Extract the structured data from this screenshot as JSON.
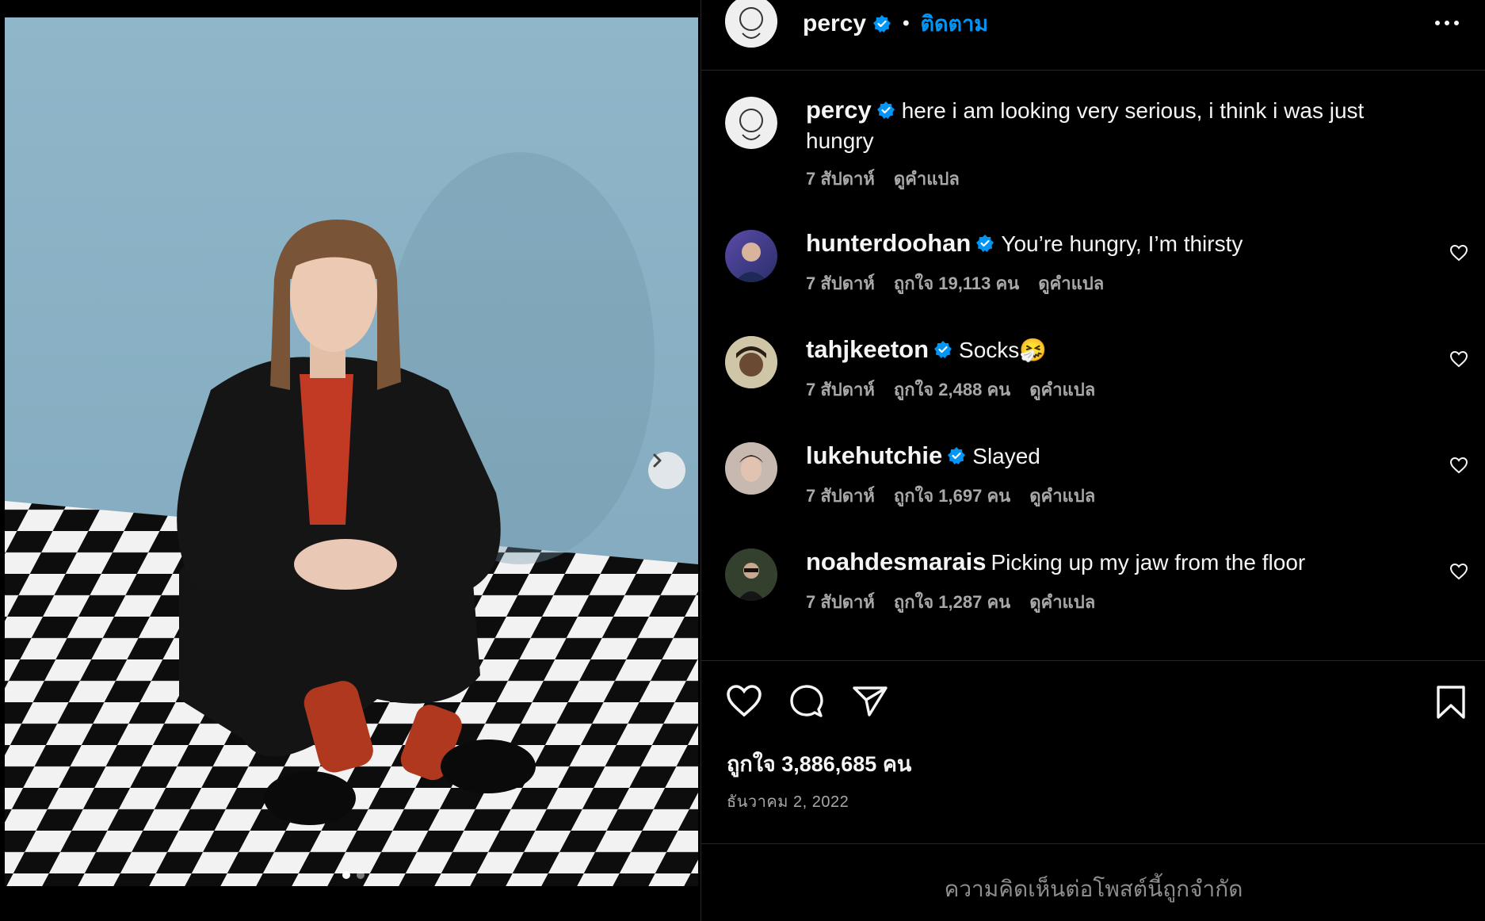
{
  "post": {
    "author": "percy",
    "follow_label": "ติดตาม",
    "dot_separator": "•",
    "caption_author": "percy",
    "caption_text": "here i am looking very serious, i think i was just hungry",
    "caption_time": "7 สัปดาห์",
    "caption_translate": "ดูคำแปล",
    "likes": "ถูกใจ 3,886,685 คน",
    "date": "ธันวาคม 2, 2022",
    "comments_limited": "ความคิดเห็นต่อโพสต์นี้ถูกจำกัด",
    "carousel": {
      "current": 1,
      "total": 2
    }
  },
  "comments": [
    {
      "user": "hunterdoohan",
      "verified": true,
      "text": "You’re hungry, I’m thirsty",
      "time": "7 สัปดาห์",
      "likes": "ถูกใจ 19,113 คน",
      "translate": "ดูคำแปล"
    },
    {
      "user": "tahjkeeton",
      "verified": true,
      "text": "Socks🤧",
      "time": "7 สัปดาห์",
      "likes": "ถูกใจ 2,488 คน",
      "translate": "ดูคำแปล"
    },
    {
      "user": "lukehutchie",
      "verified": true,
      "text": "Slayed",
      "time": "7 สัปดาห์",
      "likes": "ถูกใจ 1,697 คน",
      "translate": "ดูคำแปล"
    },
    {
      "user": "noahdesmarais",
      "verified": false,
      "text": "Picking up my jaw from the floor",
      "time": "7 สัปดาห์",
      "likes": "ถูกใจ 1,287 คน",
      "translate": "ดูคำแปล"
    }
  ],
  "icons": {
    "verified": "verified-badge-icon",
    "more": "more-options-icon",
    "like": "heart-icon",
    "comment": "comment-bubble-icon",
    "share": "paper-plane-icon",
    "save": "bookmark-icon",
    "next": "chevron-right-icon"
  },
  "colors": {
    "accent": "#0095f6",
    "verified": "#0095f6",
    "muted": "#a8a8a8",
    "background": "#000000"
  }
}
